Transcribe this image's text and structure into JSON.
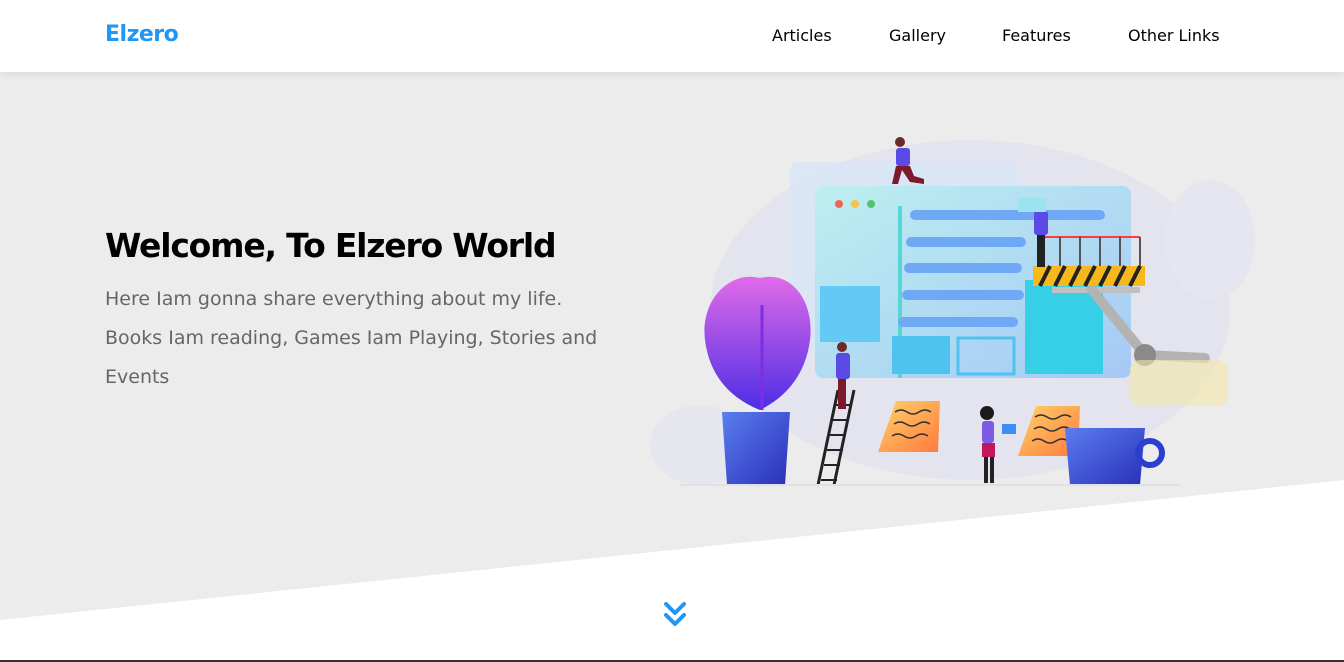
{
  "header": {
    "logo": "Elzero",
    "nav": [
      {
        "label": "Articles"
      },
      {
        "label": "Gallery"
      },
      {
        "label": "Features"
      },
      {
        "label": "Other Links"
      }
    ]
  },
  "hero": {
    "title": "Welcome, To Elzero World",
    "text": "Here Iam gonna share everything about my life. Books Iam reading, Games Iam Playing, Stories and Events"
  },
  "icons": {
    "go_down": "double-chevron-down-icon"
  },
  "colors": {
    "brand": "#2196f3",
    "hero_background": "#ececec",
    "text_muted": "#666666"
  }
}
